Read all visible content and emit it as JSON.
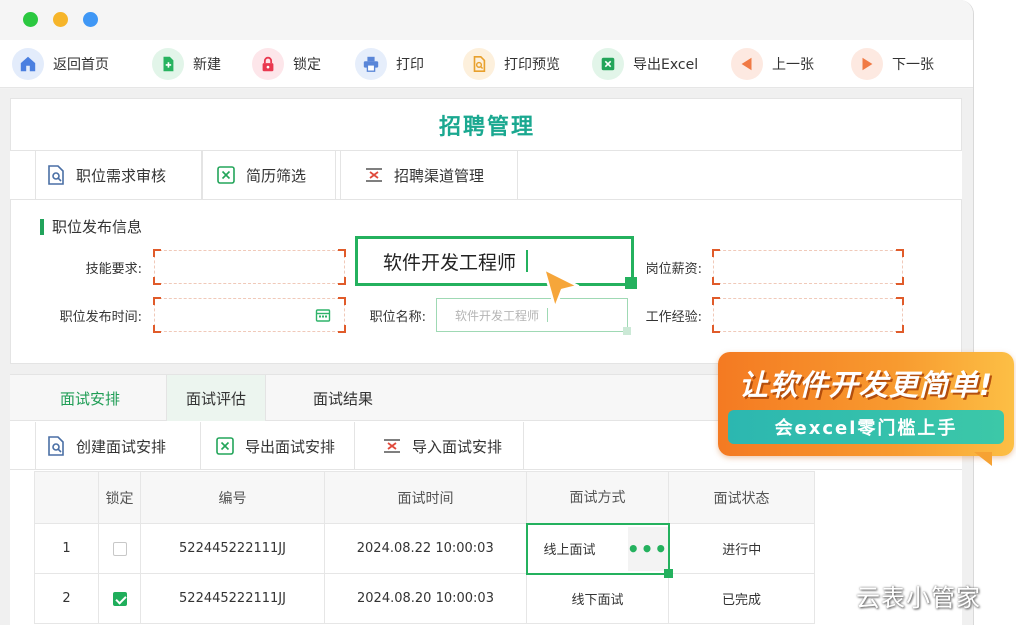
{
  "toolbar": {
    "home": "返回首页",
    "new": "新建",
    "lock": "锁定",
    "print": "打印",
    "preview": "打印预览",
    "export": "导出Excel",
    "prev": "上一张",
    "next": "下一张"
  },
  "page": {
    "title": "招聘管理"
  },
  "subbar": {
    "review": "职位需求审核",
    "screen": "简历筛选",
    "channel": "招聘渠道管理"
  },
  "section": {
    "title": "职位发布信息"
  },
  "form": {
    "skill_label": "技能要求:",
    "publish_time_label": "职位发布时间:",
    "job_name_label": "职位名称:",
    "job_name_value": "软件开发工程师",
    "job_name_hint": "软件开发工程师",
    "salary_label": "岗位薪资:",
    "experience_label": "工作经验:"
  },
  "tabs": [
    "面试安排",
    "面试评估",
    "面试结果"
  ],
  "actions": {
    "create": "创建面试安排",
    "export": "导出面试安排",
    "import": "导入面试安排"
  },
  "table": {
    "headers": [
      "",
      "锁定",
      "编号",
      "面试时间",
      "面试方式",
      "面试状态"
    ],
    "rows": [
      {
        "index": "1",
        "locked": false,
        "code": "522445222111JJ",
        "time": "2024.08.22 10:00:03",
        "method": "线上面试",
        "status": "进行中"
      },
      {
        "index": "2",
        "locked": true,
        "code": "522445222111JJ",
        "time": "2024.08.20 10:00:03",
        "method": "线下面试",
        "status": "已完成"
      }
    ]
  },
  "promo": {
    "headline": "让软件开发更简单!",
    "tagline": "会excel零门槛上手"
  },
  "watermark": "云表小管家",
  "colors": {
    "accent": "#24b15e",
    "title": "#1aa890",
    "promo": "#f47a22"
  }
}
